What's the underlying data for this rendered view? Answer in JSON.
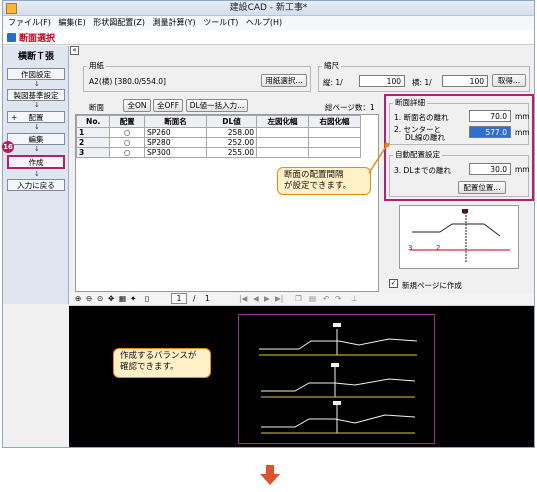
{
  "window": {
    "title": "建設CAD - 新工事*"
  },
  "menu": [
    "ファイル(F)",
    "編集(E)",
    "形状図配置(Z)",
    "測量計算(Y)",
    "ツール(T)",
    "ヘルプ(H)"
  ],
  "panel": {
    "title": "断面選択"
  },
  "sidebar": {
    "title": "横断Ｔ張",
    "buttons": [
      "作図設定",
      "製図基準設定",
      "配置",
      "編集",
      "作成",
      "入力に戻る"
    ],
    "plus": "+",
    "step_badge": "16"
  },
  "paper": {
    "group_label": "用紙",
    "value": "A2(横) [380.0/554.0]",
    "select_button": "用紙選択..."
  },
  "scale": {
    "group_label": "縮尺",
    "vertical_label": "縦: 1/",
    "vertical_value": "100",
    "horizontal_label": "横: 1/",
    "horizontal_value": "100",
    "fetch_button": "取得..."
  },
  "section_toolbar": {
    "label": "断面",
    "all_on": "全ON",
    "all_off": "全OFF",
    "dl_bulk": "DL値一括入力...",
    "total_pages": "総ページ数：1"
  },
  "table": {
    "headers": [
      "No.",
      "配置",
      "断面名",
      "DL値",
      "左図化幅",
      "右図化幅"
    ],
    "rows": [
      {
        "no": "1",
        "place": "○",
        "name": "SP260",
        "dl": "258.00",
        "left": "",
        "right": ""
      },
      {
        "no": "2",
        "place": "○",
        "name": "SP280",
        "dl": "252.00",
        "left": "",
        "right": ""
      },
      {
        "no": "3",
        "place": "○",
        "name": "SP300",
        "dl": "255.00",
        "left": "",
        "right": ""
      }
    ]
  },
  "detail": {
    "group_label": "断面詳細",
    "row1_label": "1. 断面名の離れ",
    "row1_value": "70.0",
    "row2_label_a": "2. センターと",
    "row2_label_b": "DL線の離れ",
    "row2_value": "577.0",
    "unit": "mm",
    "auto_group_label": "自動配置設定",
    "row3_label": "3. DLまでの離れ",
    "row3_value": "30.0",
    "place_button": "配置位置..."
  },
  "callouts": {
    "spacing": "断面の配置間隔\nが設定できます。",
    "balance": "作成するバランスが\n確認できます。"
  },
  "new_page": {
    "label": "新規ページに作成",
    "checked": true
  },
  "preview_toolbar": {
    "page_current": "1",
    "page_sep": "/",
    "page_total": "1"
  },
  "diagram_labels": [
    "1",
    "2",
    "3"
  ],
  "colors": {
    "accent": "#c0001a",
    "highlight": "#b0216e",
    "callout_bg": "#fff0c8",
    "callout_border": "#e48a1a",
    "arrow": "#e0522b"
  }
}
